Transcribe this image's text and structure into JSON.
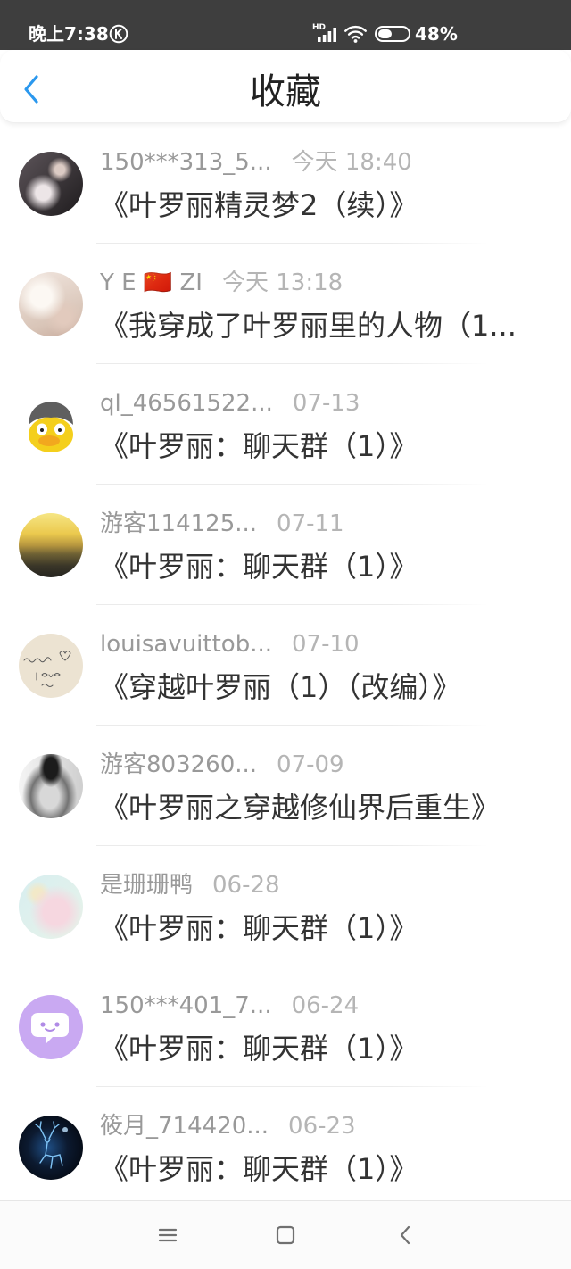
{
  "colors": {
    "accent": "#2b98ee",
    "status_bar_bg": "#3e3e3e",
    "title_text": "#333333",
    "user_text": "#999999",
    "time_text": "#b5b5b5"
  },
  "status_bar": {
    "time": "晚上7:38",
    "notification_icon": "k-circle-icon",
    "network_label": "HD",
    "signal_icon": "signal-bars-icon",
    "wifi_icon": "wifi-icon",
    "battery_icon": "battery-icon",
    "battery_level": 0.48,
    "battery_label": "48%"
  },
  "header": {
    "back_icon": "chevron-left-icon",
    "title": "收藏"
  },
  "favorites": [
    {
      "user": "150***313_5...",
      "time": "今天 18:40",
      "title": "《叶罗丽精灵梦2（续）》"
    },
    {
      "user": "Y E 🇨🇳 ZI",
      "time": "今天 13:18",
      "title": "《我穿成了叶罗丽里的人物（1..."
    },
    {
      "user": "ql_46561522...",
      "time": "07-13",
      "title": "《叶罗丽：聊天群（1）》"
    },
    {
      "user": "游客114125...",
      "time": "07-11",
      "title": "《叶罗丽：聊天群（1）》"
    },
    {
      "user": "louisavuittob...",
      "time": "07-10",
      "title": "《穿越叶罗丽（1）（改编）》"
    },
    {
      "user": "游客803260...",
      "time": "07-09",
      "title": "《叶罗丽之穿越修仙界后重生》"
    },
    {
      "user": "是珊珊鸭",
      "time": "06-28",
      "title": "《叶罗丽：聊天群（1）》"
    },
    {
      "user": "150***401_7...",
      "time": "06-24",
      "title": "《叶罗丽：聊天群（1）》"
    },
    {
      "user": "筱月_714420...",
      "time": "06-23",
      "title": "《叶罗丽：聊天群（1）》"
    }
  ],
  "nav_bar": {
    "menu_icon": "menu-icon",
    "home_icon": "square-home-icon",
    "back_icon": "back-chevron-icon"
  }
}
